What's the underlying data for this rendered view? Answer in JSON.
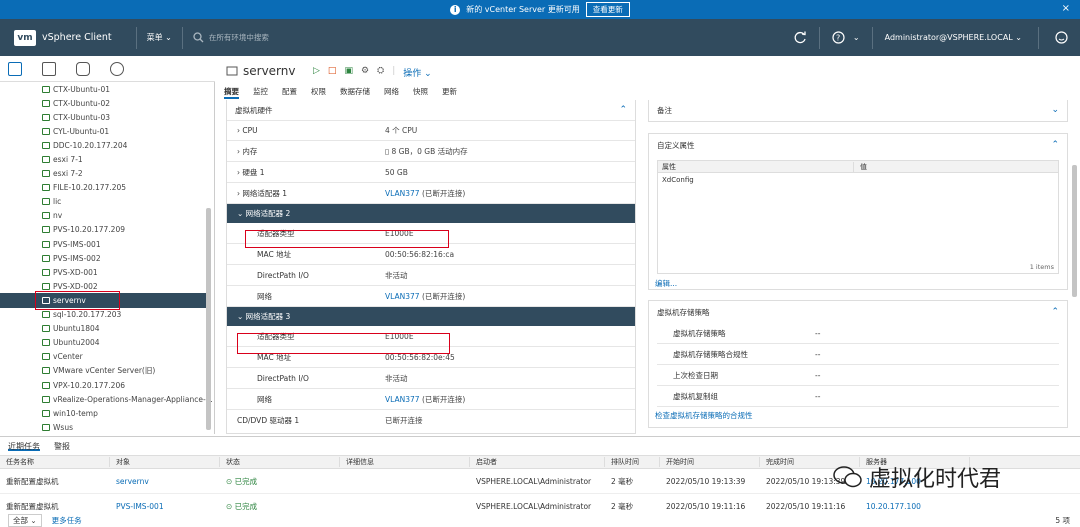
{
  "banner": {
    "message": "新的 vCenter Server 更新可用",
    "button": "查看更新",
    "close": "×"
  },
  "topbar": {
    "logo": "vm",
    "app_name": "vSphere Client",
    "menu": "菜单 ⌄",
    "search_placeholder": "在所有环境中搜索",
    "user": "Administrator@VSPHERE.LOCAL ⌄"
  },
  "tree": {
    "items": [
      "CTX-Ubuntu-01",
      "CTX-Ubuntu-02",
      "CTX-Ubuntu-03",
      "CYL-Ubuntu-01",
      "DDC-10.20.177.204",
      "esxi 7-1",
      "esxi 7-2",
      "FILE-10.20.177.205",
      "lic",
      "nv",
      "PVS-10.20.177.209",
      "PVS-IMS-001",
      "PVS-IMS-002",
      "PVS-XD-001",
      "PVS-XD-002",
      "servernv",
      "sql-10.20.177.203",
      "Ubuntu1804",
      "Ubuntu2004",
      "vCenter",
      "VMware vCenter Server(旧)",
      "VPX-10.20.177.206",
      "vRealize-Operations-Manager-Appliance-...",
      "win10-temp",
      "Wsus"
    ]
  },
  "vm": {
    "name": "servernv",
    "actions_label": "操作 ⌄"
  },
  "tabs": [
    "摘要",
    "监控",
    "配置",
    "权限",
    "数据存储",
    "网络",
    "快照",
    "更新"
  ],
  "hardware": {
    "title": "虚拟机硬件",
    "cpu_k": "CPU",
    "cpu_v": "4 个 CPU",
    "mem_k": "内存",
    "mem_v": "8 GB，0 GB 活动内存",
    "disk_k": "硬盘 1",
    "disk_v": "50 GB",
    "na1_k": "网络适配器 1",
    "na1_v": "VLAN377",
    "na1_s": "(已断开连接)",
    "na2_h": "网络适配器 2",
    "na3_h": "网络适配器 3",
    "type_k": "适配器类型",
    "mac_k": "MAC 地址",
    "dp_k": "DirectPath I/O",
    "net_k": "网络",
    "na2_type": "E1000E",
    "na2_mac": "00:50:56:82:16:ca",
    "na2_dp": "非活动",
    "na2_net": "VLAN377",
    "na2_net_s": "(已断开连接)",
    "na3_type": "E1000E",
    "na3_mac": "00:50:56:82:0e:45",
    "na3_dp": "非活动",
    "na3_net": "VLAN377",
    "na3_net_s": "(已断开连接)",
    "cd_k": "CD/DVD 驱动器 1",
    "cd_v": "已断开连接"
  },
  "notes": {
    "title": "备注"
  },
  "custom": {
    "title": "自定义属性",
    "col1": "属性",
    "col2": "值",
    "row": "XdConfig",
    "count": "1 items",
    "edit": "编辑..."
  },
  "storage": {
    "title": "虚拟机存储策略",
    "r1": "虚拟机存储策略",
    "r2": "虚拟机存储策略合规性",
    "r3": "上次检查日期",
    "r4": "虚拟机复制组",
    "dash": "--",
    "link": "检查虚拟机存储策略的合规性"
  },
  "bottom": {
    "tab_recent": "近期任务",
    "tab_alarm": "警报",
    "cols": [
      "任务名称",
      "对象",
      "状态",
      "详细信息",
      "启动者",
      "排队时间",
      "开始时间",
      "完成时间",
      "服务器"
    ],
    "rows": [
      [
        "重新配置虚拟机",
        "servernv",
        "已完成",
        "",
        "VSPHERE.LOCAL\\Administrator",
        "2 毫秒",
        "2022/05/10 19:13:39",
        "2022/05/10 19:13:39",
        "10.20.177.100"
      ],
      [
        "重新配置虚拟机",
        "PVS-IMS-001",
        "已完成",
        "",
        "VSPHERE.LOCAL\\Administrator",
        "2 毫秒",
        "2022/05/10 19:11:16",
        "2022/05/10 19:11:16",
        "10.20.177.100"
      ]
    ],
    "filter": "全部",
    "more": "更多任务",
    "count": "5 项"
  },
  "watermark": "虚拟化时代君"
}
